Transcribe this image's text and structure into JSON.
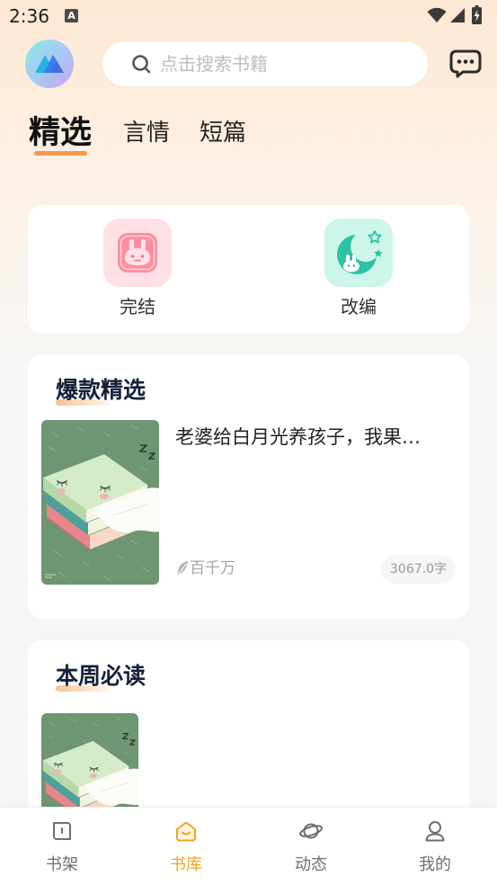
{
  "colors": {
    "accent": "#f5a221",
    "tab_underline": "#f29b4b",
    "title_highlight": "#f7c38f",
    "cover_background": "#6f9672"
  },
  "status_bar": {
    "time": "2:36",
    "notification_label": "A",
    "icons": [
      "a-notification-icon",
      "wifi-icon",
      "signal-icon",
      "battery-icon"
    ]
  },
  "header": {
    "logo_icon": "app-logo-icon",
    "search": {
      "icon": "search-icon",
      "placeholder": "点击搜索书籍"
    },
    "message_icon": "chat-bubble-icon"
  },
  "tabs": [
    {
      "label": "精选",
      "active": true
    },
    {
      "label": "言情",
      "active": false
    },
    {
      "label": "短篇",
      "active": false
    }
  ],
  "categories": [
    {
      "label": "完结",
      "icon": "bunny-icon"
    },
    {
      "label": "改编",
      "icon": "moon-bunny-icon"
    }
  ],
  "sections": [
    {
      "title": "爆款精选",
      "books": [
        {
          "title": "老婆给白月光养孩子，我果…",
          "author": "百千万",
          "author_icon": "feather-icon",
          "word_count": "3067.0字",
          "cover": "sleeping-books-cover"
        }
      ]
    },
    {
      "title": "本周必读",
      "books": [
        {
          "cover": "sleeping-books-cover"
        }
      ]
    }
  ],
  "bottom_nav": [
    {
      "label": "书架",
      "icon": "book-icon",
      "active": false
    },
    {
      "label": "书库",
      "icon": "store-icon",
      "active": true
    },
    {
      "label": "动态",
      "icon": "planet-icon",
      "active": false
    },
    {
      "label": "我的",
      "icon": "user-icon",
      "active": false
    }
  ]
}
